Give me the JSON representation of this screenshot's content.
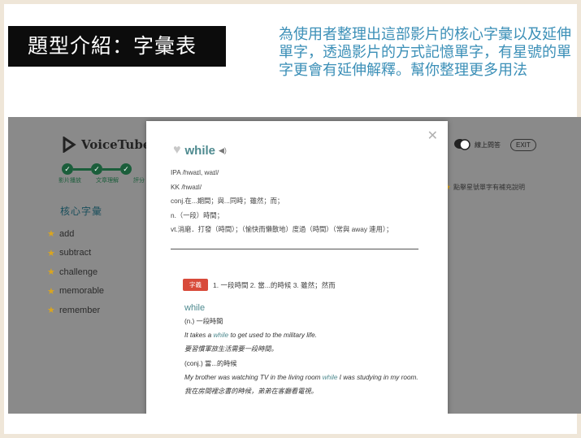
{
  "slide": {
    "title": "題型介紹：字彙表",
    "caption": "為使用者整理出這部影片的核心字彙以及延伸單字，透過影片的方式記憶單字，有星號的單字更會有延伸解釋。幫你整理更多用法"
  },
  "app": {
    "logo_text": "VoiceTube",
    "steps": [
      "1",
      "2",
      "3"
    ],
    "step_labels": [
      "影片播放",
      "文章理解",
      "評分"
    ],
    "vocab_title": "核心字彙",
    "vocab_items": [
      "add",
      "subtract",
      "challenge",
      "memorable",
      "remember"
    ],
    "qa_label": "線上問答",
    "exit_label": "EXIT",
    "star_note": "點擊星號單字有補充說明"
  },
  "popup": {
    "word": "while",
    "ipa": "IPA /hwaɪl, waɪl/",
    "kk": "KK /hwaɪl/",
    "def_conj": "conj.在...期間；與...同時；雖然；而；",
    "def_n": "n.（一段）時間；",
    "def_vt": "vt.消磨．打發（時間）；（愉快而懶散地）度過（時間）（常與 away 連用）；",
    "tag_label": "字義",
    "tag_meanings": "1. 一段時間 2. 當...的時候 3. 雖然；然而",
    "entry_word": "while",
    "entry_n": "(n.) 一段時間",
    "ex1_before": "It takes a ",
    "ex1_word": "while",
    "ex1_after": " to get used to the military life.",
    "ex1_zh": "要習慣軍旅生活需要一段時間。",
    "entry_conj": "(conj.) 當...的時候",
    "ex2_before": "My brother was watching TV in the living room ",
    "ex2_word": "while",
    "ex2_after": " I was studying in my room.",
    "ex2_zh": "我在房間裡念書的時候，弟弟在客廳看電視。"
  },
  "colors": {
    "caption": "#3b8fb7",
    "accent_green": "#1b5e3b",
    "word_teal": "#4e8a8f",
    "tag_red": "#d84a3a",
    "star": "#d9a520"
  },
  "icons": [
    "logo-icon",
    "heart-icon",
    "speaker-icon",
    "close-icon",
    "star-icon",
    "chat-icon",
    "check-icon"
  ]
}
